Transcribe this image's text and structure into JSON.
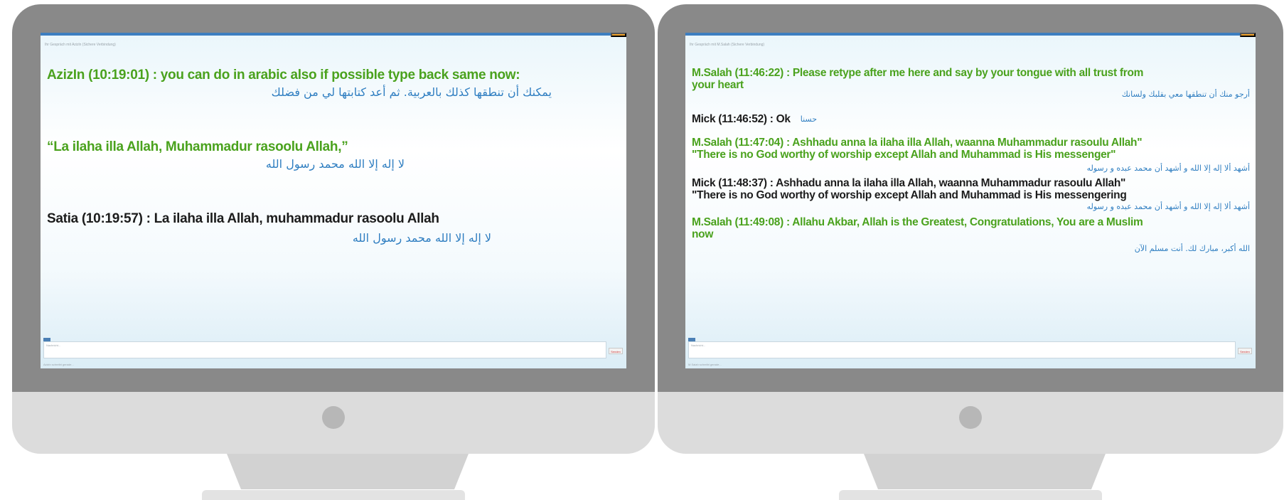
{
  "left_screen": {
    "window": {
      "badge_label": "Beenden",
      "header_text": "Ihr Gespräch mit Azizln (Sichere Verbindung)",
      "send_label": "Senden",
      "input_placeholder": "Nachricht...",
      "status_text": "Azizln schreibt gerade..."
    },
    "messages": [
      {
        "text": "AzizIn (10:19:01) : you can do in arabic also if possible type back same now:",
        "arabic": "يمكنك أن تنطقها كذلك بالعربية. ثم أعد كتابتها لي من فضلك"
      },
      {
        "text": "“La ilaha illa Allah, Muhammadur rasoolu Allah,”",
        "arabic": "لا إله إلا الله محمد رسول الله"
      },
      {
        "text": "Satia (10:19:57) : La ilaha illa Allah, muhammadur rasoolu Allah",
        "arabic": "لا إله إلا الله محمد رسول الله"
      }
    ]
  },
  "right_screen": {
    "window": {
      "badge_label": "Beenden",
      "header_text": "Ihr Gespräch mit M.Salah (Sichere Verbindung)",
      "send_label": "Senden",
      "input_placeholder": "Nachricht...",
      "status_text": "M.Salah schreibt gerade..."
    },
    "messages": [
      {
        "line1": "M.Salah (11:46:22) : Please retype after me here and say by your tongue with all trust from",
        "line2": "your heart",
        "arabic": "أرجو منك أن تنطقها معي بقلبك ولسانك"
      },
      {
        "line1": "Mick (11:46:52) : Ok",
        "arabic": "حسنا"
      },
      {
        "line1": "M.Salah (11:47:04) : Ashhadu anna la ilaha illa Allah, waanna Muhammadur rasoulu Allah\"",
        "line2": "\"There is no God worthy of worship except Allah and Muhammad is His messenger\"",
        "arabic": "أشهد ألا إله إلا الله و أشهد أن محمد عبده و رسوله"
      },
      {
        "line1": "Mick (11:48:37) : Ashhadu anna la ilaha illa Allah, waanna Muhammadur rasoulu Allah\"",
        "line2": "\"There is no God worthy of worship except Allah and Muhammad is His messengering",
        "arabic": "أشهد ألا إله إلا الله و أشهد أن محمد عبده و رسوله"
      },
      {
        "line1": "M.Salah (11:49:08) : Allahu Akbar, Allah is the Greatest, Congratulations, You are a Muslim",
        "line2": "now",
        "arabic": "الله أكبر، مبارك لك. أنت مسلم الآن"
      }
    ]
  },
  "colors": {
    "sender_green": "#4aa21d",
    "sender_black": "#1c1c1c",
    "arabic_blue": "#2f7ec1",
    "bezel": "#898989",
    "chin": "#dcdcdc"
  }
}
